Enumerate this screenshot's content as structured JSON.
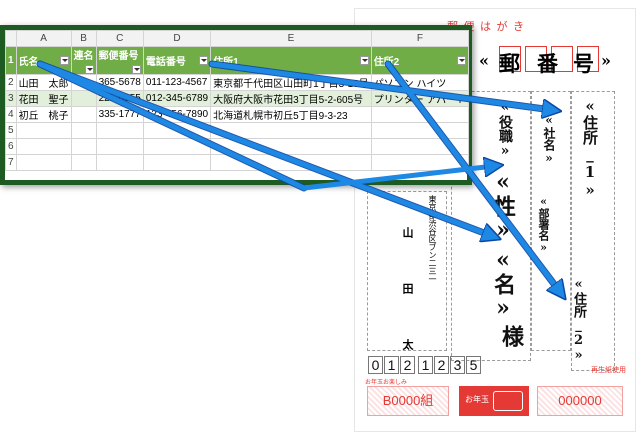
{
  "postcard": {
    "header": "郵 便 は が き",
    "zip_field": [
      "«",
      "郵",
      "番",
      "号",
      "»"
    ],
    "field_address1": "«住所_1»",
    "field_address2": "«住所_2»",
    "field_company": "«社名»",
    "field_title": "«役職»",
    "field_dept": "«部署名»",
    "field_last": "«性»",
    "field_first": "«名»",
    "honorific": "様",
    "sender_address": "東京都渋谷区ブン二三一",
    "sender_name": "山 田 太 郎",
    "sender_zip": [
      "0",
      "1",
      "2",
      "1",
      "2",
      "3",
      "5"
    ],
    "lottery_note": "お年玉お楽しみ",
    "recycled_note": "再生紙使用",
    "lottery_group": "B0000組",
    "stamp_text": "お年玉",
    "lottery_number": "000000"
  },
  "excel": {
    "columns": [
      "A",
      "B",
      "C",
      "D",
      "E",
      "F"
    ],
    "row_numbers": [
      "1",
      "2",
      "3",
      "4",
      "5",
      "6",
      "7"
    ],
    "headers": [
      "氏名",
      "連名",
      "郵便番号",
      "電話番号",
      "住所1",
      "住所2"
    ],
    "rows": [
      [
        "山田　太郎",
        "",
        "365-5678",
        "011-123-4567",
        "東京都千代田区山田町1丁目3-10号",
        "パソコン ハイツ"
      ],
      [
        "花田　聖子",
        "",
        "225-0055",
        "012-345-6789",
        "大阪府大阪市花田3丁目5-2-605号",
        "プリンター アパート"
      ],
      [
        "初丘　桃子",
        "",
        "335-1777",
        "123-456-7890",
        "北海道札幌市初丘5丁目9-3-23",
        ""
      ]
    ]
  },
  "colors": {
    "excel_border": "#1d5b22",
    "header_green": "#70ad47",
    "band_green": "#e2efda",
    "arrow_blue": "#1e88e5",
    "postcard_red": "#e53935"
  }
}
